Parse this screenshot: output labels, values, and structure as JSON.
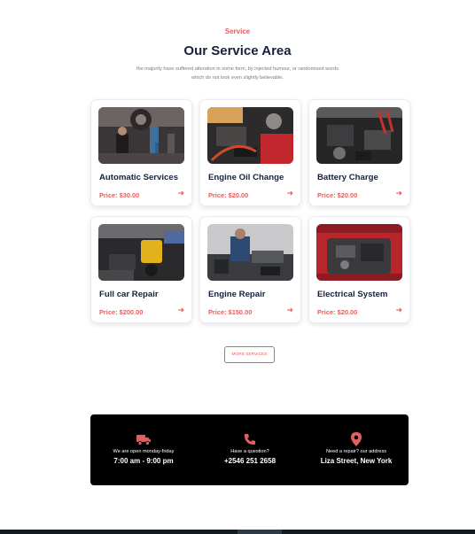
{
  "section": {
    "eyebrow": "Service",
    "title": "Our Service Area",
    "subtitle": "the majority have suffered alteration in some form, by injected humour, or randomised words which do not look even slightly believable."
  },
  "services": [
    {
      "title": "Automatic Services",
      "price": "Price: $30.00",
      "image": "mechanic-under-car-photo"
    },
    {
      "title": "Engine Oil Change",
      "price": "Price: $20.00",
      "image": "engine-bay-red-photo"
    },
    {
      "title": "Battery Charge",
      "price": "Price: $20.00",
      "image": "battery-jump-photo"
    },
    {
      "title": "Full car Repair",
      "price": "Price: $200.00",
      "image": "oil-pour-photo"
    },
    {
      "title": "Engine Repair",
      "price": "Price: $150.00",
      "image": "mechanic-engine-photo"
    },
    {
      "title": "Electrical System",
      "price": "Price: $20.00",
      "image": "red-car-engine-photo"
    }
  ],
  "more_button": "MORE SERVICES",
  "info": [
    {
      "icon": "truck-icon",
      "label": "We are open monday-friday",
      "value": "7:00 am - 9:00 pm"
    },
    {
      "icon": "phone-icon",
      "label": "Have a question?",
      "value": "+2546 251 2658"
    },
    {
      "icon": "location-pin-icon",
      "label": "Need a repair? our address",
      "value": "Liza Street, New York"
    }
  ],
  "colors": {
    "accent": "#e0605e",
    "heading": "#16213a",
    "info_bg": "#000000"
  }
}
